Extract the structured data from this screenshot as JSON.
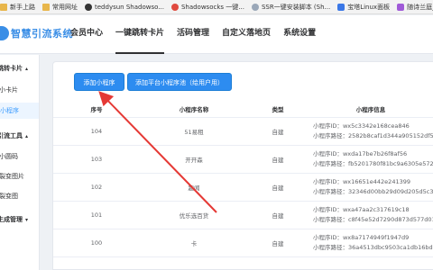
{
  "bookmarks": [
    {
      "label": "新手上路",
      "icon": "folder-icon",
      "color": "folder"
    },
    {
      "label": "常用网址",
      "icon": "folder-icon",
      "color": "folder"
    },
    {
      "label": "teddysun Shadowso...",
      "icon": "github-icon",
      "color": "dark"
    },
    {
      "label": "Shadowsocks 一键...",
      "icon": "shadowsocks-icon",
      "color": "red"
    },
    {
      "label": "SSR一键安装脚本 (Sh...",
      "icon": "globe-icon",
      "color": "light"
    },
    {
      "label": "宝塔Linux面板",
      "icon": "bt-panel-icon",
      "color": "blue"
    },
    {
      "label": "随诗兰庭_综合网页",
      "icon": "site-icon",
      "color": "purple"
    }
  ],
  "brand": {
    "name": "智慧引流系统"
  },
  "top_menu": [
    {
      "label": "会员中心",
      "active": false
    },
    {
      "label": "一键跳转卡片",
      "active": true
    },
    {
      "label": "活码管理",
      "active": false
    },
    {
      "label": "自定义落地页",
      "active": false
    },
    {
      "label": "系统设置",
      "active": false
    }
  ],
  "sidebar": {
    "group1": "跳转卡片",
    "item1": "小卡片",
    "item2": "小程序",
    "group2": "引流工具",
    "item3": "小圆码",
    "item4": "裂变图片",
    "item5": "裂变图",
    "group3": "生成管理"
  },
  "buttons": {
    "add_miniprogram": "添加小程序",
    "add_platform": "添加平台小程序池（给用户用）"
  },
  "table": {
    "headers": [
      "序号",
      "小程序名称",
      "类型",
      "小程序信息"
    ],
    "appid_label": "小程序ID：",
    "path_label": "小程序路径：",
    "rows": [
      {
        "id": "104",
        "name": "51易租",
        "type": "自建",
        "appid": "wx5c3342e168cea846",
        "path": "2582b8caf1d344a905152df5492"
      },
      {
        "id": "103",
        "name": "开开森",
        "type": "自建",
        "appid": "wxda17be7b26f8af56",
        "path": "fb5201780f81bc9a6305e572442"
      },
      {
        "id": "102",
        "name": "趣闻",
        "type": "自建",
        "appid": "wx16651e442e241399",
        "path": "32346d00bb29d09d205d5c370b"
      },
      {
        "id": "101",
        "name": "优乐选百货",
        "type": "自建",
        "appid": "wxa47aa2c317619c18",
        "path": "c8f45e52d7290d873d577d01a"
      },
      {
        "id": "100",
        "name": "卡",
        "type": "自建",
        "appid": "wx8a7174949f1947d9",
        "path": "36a4513dbc9503ca1db16bd8"
      }
    ]
  },
  "colors": {
    "primary": "#2d8cf0",
    "arrow": "#e53935"
  }
}
